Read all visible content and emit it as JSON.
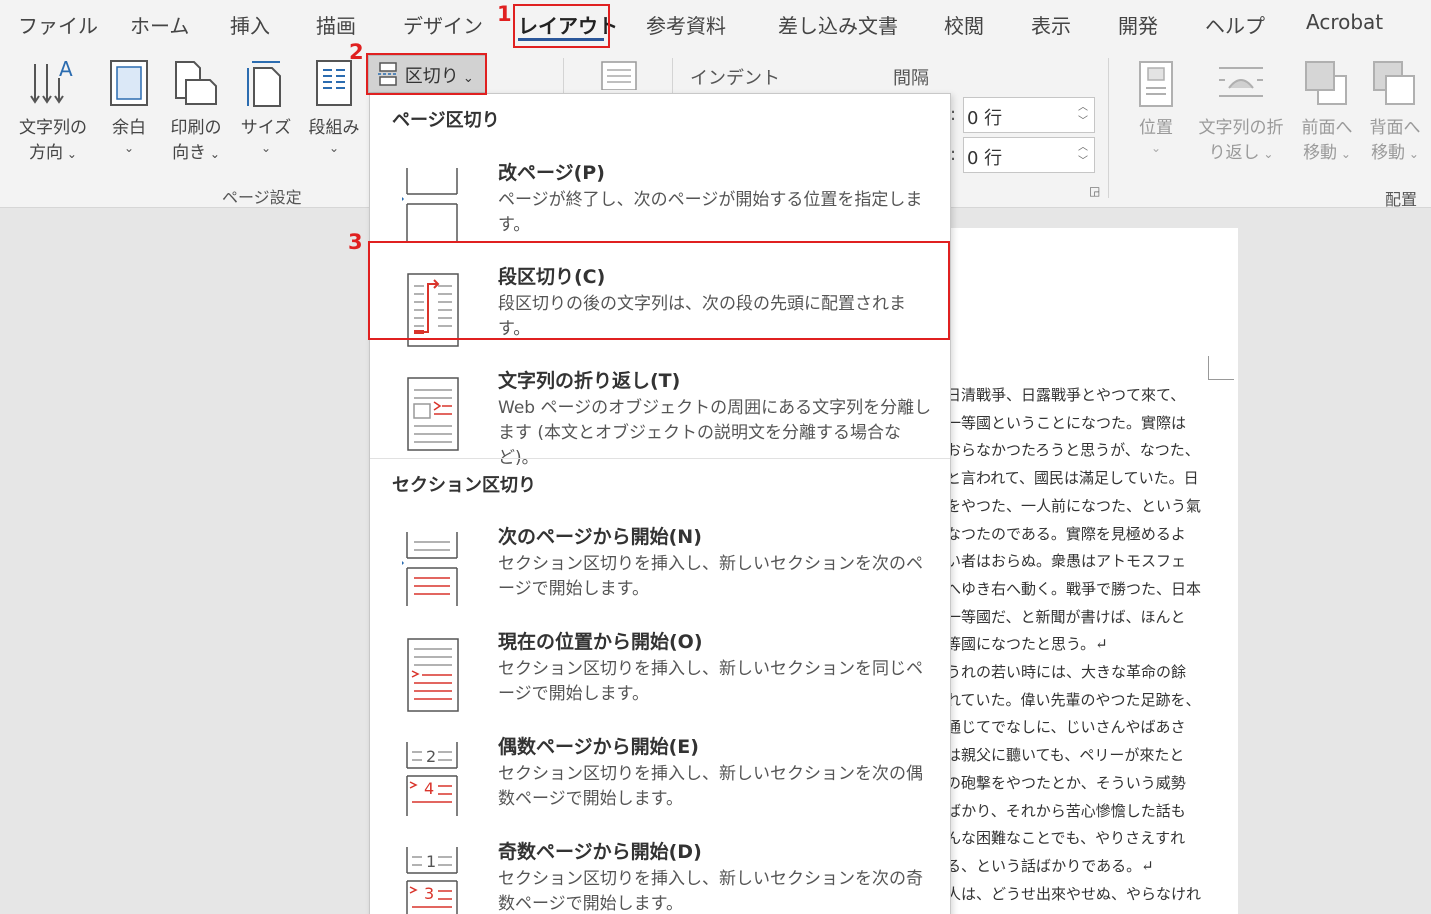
{
  "menu": {
    "tabs": [
      "ファイル",
      "ホーム",
      "挿入",
      "描画",
      "デザイン",
      "レイアウト",
      "参考資料",
      "差し込み文書",
      "校閲",
      "表示",
      "開発",
      "ヘルプ",
      "Acrobat"
    ],
    "active_tab": "レイアウト"
  },
  "ribbon": {
    "text_direction": {
      "line1": "文字列の",
      "line2": "方向"
    },
    "margins": "余白",
    "orientation": {
      "line1": "印刷の",
      "line2": "向き"
    },
    "size": "サイズ",
    "columns": "段組み",
    "page_setup_label": "ページ設定",
    "breaks_label": "区切り",
    "indent_label": "インデント",
    "spacing_label": "間隔",
    "spacing_before": "0 行",
    "spacing_after": "0 行",
    "position": "位置",
    "wrap_text": {
      "line1": "文字列の折",
      "line2": "り返し"
    },
    "bring_forward": {
      "line1": "前面へ",
      "line2": "移動"
    },
    "send_backward": {
      "line1": "背面へ",
      "line2": "移動"
    },
    "arrange_label": "配置"
  },
  "dropdown": {
    "page_breaks_header": "ページ区切り",
    "section_breaks_header": "セクション区切り",
    "items": [
      {
        "title": "改ページ(P)",
        "desc": "ページが終了し、次のページが開始する位置を指定します。"
      },
      {
        "title": "段区切り(C)",
        "desc": "段区切りの後の文字列は、次の段の先頭に配置されます。"
      },
      {
        "title": "文字列の折り返し(T)",
        "desc": "Web ページのオブジェクトの周囲にある文字列を分離します (本文とオブジェクトの説明文を分離する場合など)。"
      },
      {
        "title": "次のページから開始(N)",
        "desc": "セクション区切りを挿入し、新しいセクションを次のページで開始します。"
      },
      {
        "title": "現在の位置から開始(O)",
        "desc": "セクション区切りを挿入し、新しいセクションを同じページで開始します。"
      },
      {
        "title": "偶数ページから開始(E)",
        "desc": "セクション区切りを挿入し、新しいセクションを次の偶数ページで開始します。"
      },
      {
        "title": "奇数ページから開始(D)",
        "desc": "セクション区切りを挿入し、新しいセクションを次の奇数ページで開始します。"
      }
    ]
  },
  "document_lines": [
    "日清戰爭、日露戰爭とやつて來て、",
    "一等國ということになつた。實際は",
    "おらなかつたろうと思うが、なつた、",
    "と言われて、國民は滿足していた。日",
    "をやつた、一人前になつた、という氣",
    "なつたのである。實際を見極めるよ",
    "い者はおらぬ。衆愚はアトモスフェ",
    "へゆき右へ動く。戰爭で勝つた、日本",
    "一等國だ、と新聞が書けば、ほんと",
    "等國になつたと思う。↵",
    "うれの若い時には、大きな革命の餘",
    "れていた。偉い先輩のやつた足跡を、",
    "通じてでなしに、じいさんやばあさ",
    "は親父に聽いても、ペリーが來たと",
    "の砲撃をやつたとか、そういう威勢",
    "ばかり、それから苦心慘憺した話も",
    "んな困難なことでも、やりさえすれ",
    "る、という話ばかりである。↵",
    "人は、どうせ出來やせぬ、やらなけれ"
  ],
  "annotations": {
    "step1": "1",
    "step2": "2",
    "step3": "3"
  },
  "colors": {
    "accent": "#2b579a",
    "annotation": "#e02020",
    "icon_red": "#d9342b"
  }
}
